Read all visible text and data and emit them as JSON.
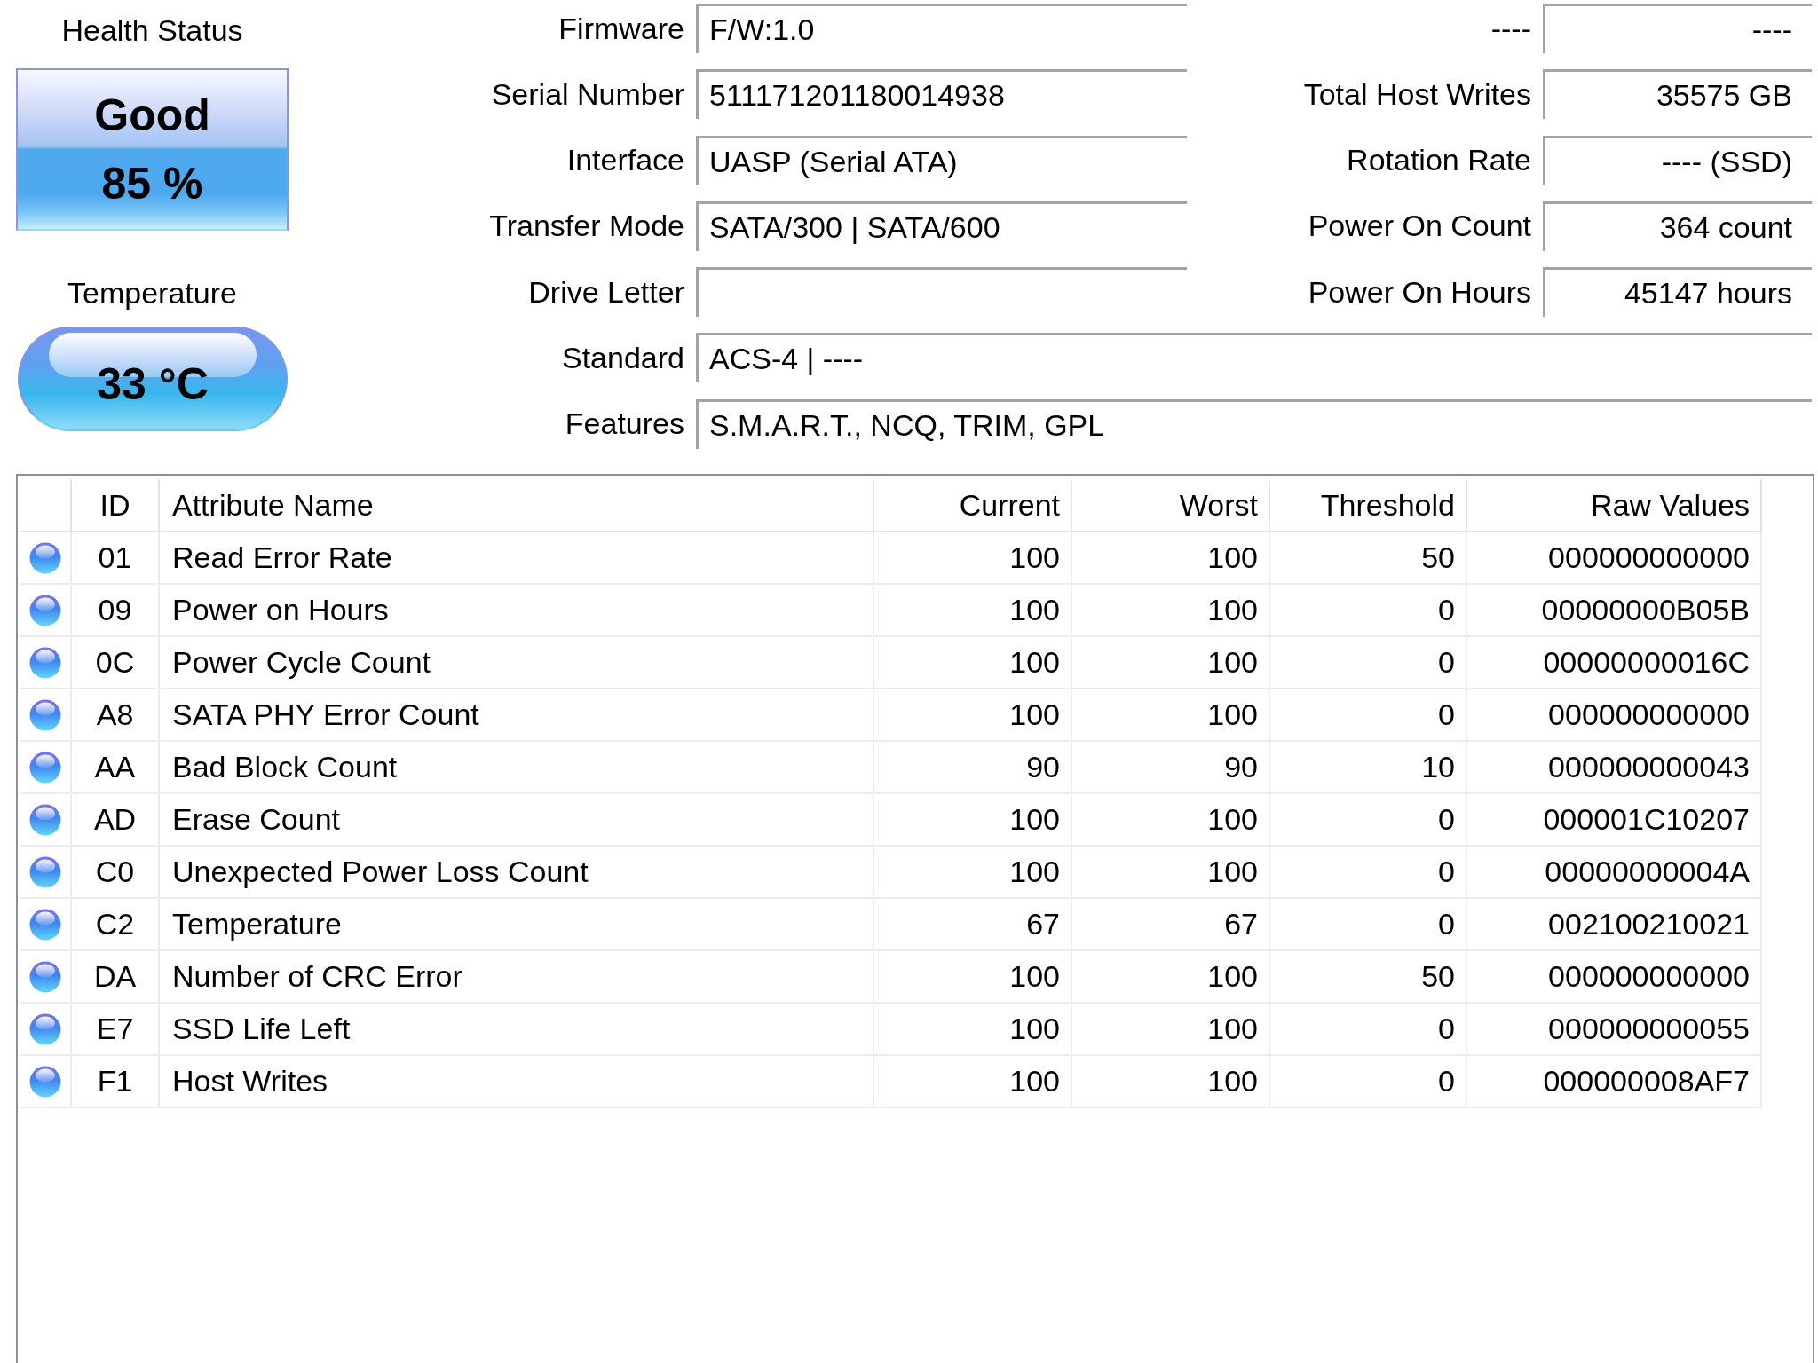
{
  "health": {
    "label": "Health Status",
    "status": "Good",
    "percent": "85 %"
  },
  "temperature": {
    "label": "Temperature",
    "value": "33 °C"
  },
  "info": [
    {
      "kind": "pair",
      "label": "Firmware",
      "value": "F/W:1.0",
      "side_label": "----",
      "side_value": "----"
    },
    {
      "kind": "pair",
      "label": "Serial Number",
      "value": "511171201180014938",
      "side_label": "Total Host Writes",
      "side_value": "35575 GB"
    },
    {
      "kind": "pair",
      "label": "Interface",
      "value": "UASP (Serial ATA)",
      "side_label": "Rotation Rate",
      "side_value": "---- (SSD)"
    },
    {
      "kind": "pair",
      "label": "Transfer Mode",
      "value": "SATA/300 | SATA/600",
      "side_label": "Power On Count",
      "side_value": "364 count"
    },
    {
      "kind": "pair",
      "label": "Drive Letter",
      "side_label": "Power On Hours",
      "side_value": "45147 hours"
    },
    {
      "kind": "wide",
      "label": "Standard",
      "value": "ACS-4 | ----"
    },
    {
      "kind": "wide",
      "label": "Features",
      "value": "S.M.A.R.T., NCQ, TRIM, GPL"
    }
  ],
  "smart_table": {
    "columns": [
      "ID",
      "Attribute Name",
      "Current",
      "Worst",
      "Threshold",
      "Raw Values"
    ],
    "rows": [
      {
        "id": "01",
        "name": "Read Error Rate",
        "current": "100",
        "worst": "100",
        "threshold": "50",
        "raw": "000000000000"
      },
      {
        "id": "09",
        "name": "Power on Hours",
        "current": "100",
        "worst": "100",
        "threshold": "0",
        "raw": "00000000B05B"
      },
      {
        "id": "0C",
        "name": "Power Cycle Count",
        "current": "100",
        "worst": "100",
        "threshold": "0",
        "raw": "00000000016C"
      },
      {
        "id": "A8",
        "name": "SATA PHY Error Count",
        "current": "100",
        "worst": "100",
        "threshold": "0",
        "raw": "000000000000"
      },
      {
        "id": "AA",
        "name": "Bad Block Count",
        "current": "90",
        "worst": "90",
        "threshold": "10",
        "raw": "000000000043"
      },
      {
        "id": "AD",
        "name": "Erase Count",
        "current": "100",
        "worst": "100",
        "threshold": "0",
        "raw": "000001C10207"
      },
      {
        "id": "C0",
        "name": "Unexpected Power Loss Count",
        "current": "100",
        "worst": "100",
        "threshold": "0",
        "raw": "00000000004A"
      },
      {
        "id": "C2",
        "name": "Temperature",
        "current": "67",
        "worst": "67",
        "threshold": "0",
        "raw": "002100210021"
      },
      {
        "id": "DA",
        "name": "Number of CRC Error",
        "current": "100",
        "worst": "100",
        "threshold": "50",
        "raw": "000000000000"
      },
      {
        "id": "E7",
        "name": "SSD Life Left",
        "current": "100",
        "worst": "100",
        "threshold": "0",
        "raw": "000000000055"
      },
      {
        "id": "F1",
        "name": "Host Writes",
        "current": "100",
        "worst": "100",
        "threshold": "0",
        "raw": "000000008AF7"
      }
    ]
  }
}
